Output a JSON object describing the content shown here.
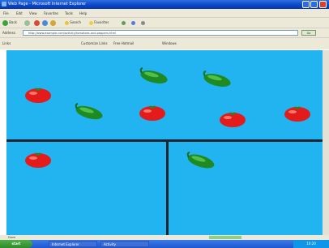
{
  "window": {
    "title": "Web Page - Microsoft Internet Explorer"
  },
  "menu": {
    "items": [
      "File",
      "Edit",
      "View",
      "Favorites",
      "Tools",
      "Help"
    ]
  },
  "toolbar": {
    "back": "Back",
    "forward": "",
    "search": "Search",
    "favorites": "Favorites"
  },
  "address": {
    "label": "Address",
    "value": "http://www.example.com/activity/tomatoes-and-peppers.html",
    "go": "Go"
  },
  "links": {
    "label": "Links",
    "items": [
      "Customize Links",
      "Free Hotmail",
      "Windows"
    ]
  },
  "status": {
    "text": "Done"
  },
  "taskbar": {
    "start": "start",
    "items": [
      "Internet Explorer",
      "Activity"
    ],
    "clock": "10:20"
  },
  "colors": {
    "stage": "#22b4f0",
    "divider": "#1c2430",
    "tomato": "#e31b1b",
    "pepper": "#1f8a22"
  },
  "stage": {
    "top_items": [
      {
        "kind": "pepper"
      },
      {
        "kind": "pepper"
      },
      {
        "kind": "tomato"
      },
      {
        "kind": "pepper"
      },
      {
        "kind": "tomato"
      },
      {
        "kind": "tomato"
      },
      {
        "kind": "tomato"
      }
    ],
    "bottom_left_items": [
      {
        "kind": "tomato"
      }
    ],
    "bottom_right_items": [
      {
        "kind": "pepper"
      }
    ]
  }
}
